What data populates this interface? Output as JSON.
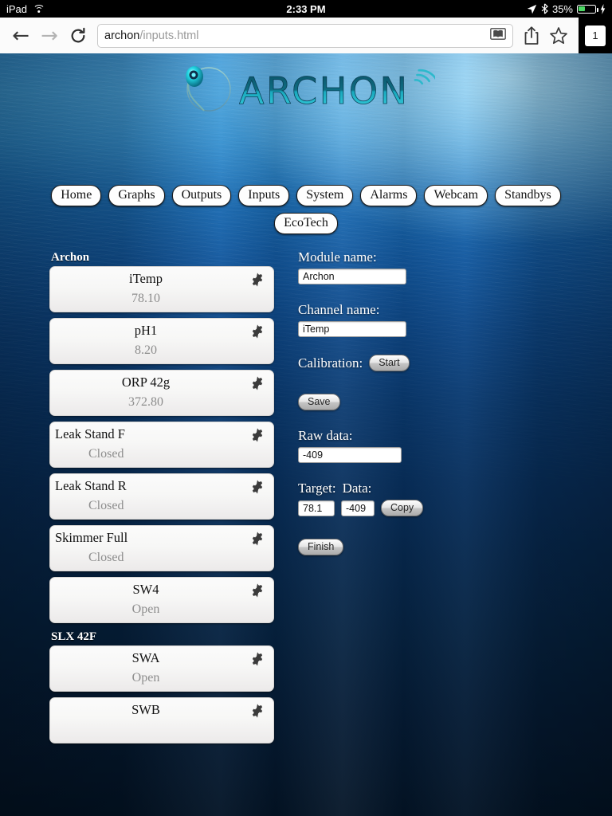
{
  "status_bar": {
    "device": "iPad",
    "wifi_icon": "wifi-icon",
    "time": "2:33 PM",
    "location_icon": "location-arrow-icon",
    "bluetooth_icon": "bluetooth-icon",
    "battery_percent": "35%",
    "battery_icon": "battery-icon",
    "charging_icon": "lightning-bolt-icon"
  },
  "browser": {
    "back_icon": "back-arrow-icon",
    "forward_icon": "forward-arrow-icon",
    "reload_icon": "reload-icon",
    "url_host": "archon",
    "url_path": "/inputs.html",
    "reader_icon": "reader-view-icon",
    "share_icon": "share-icon",
    "bookmark_icon": "star-icon",
    "tab_count": "1"
  },
  "site": {
    "logo_text": "ARCHON",
    "logo_mark_icon": "archon-circle-icon",
    "logo_wifi_icon": "signal-waves-icon"
  },
  "nav": {
    "row1": [
      {
        "label": "Home"
      },
      {
        "label": "Graphs"
      },
      {
        "label": "Outputs"
      },
      {
        "label": "Inputs"
      },
      {
        "label": "System"
      },
      {
        "label": "Alarms"
      },
      {
        "label": "Webcam"
      },
      {
        "label": "Standbys"
      }
    ],
    "row2": [
      {
        "label": "EcoTech"
      }
    ]
  },
  "groups": [
    {
      "title": "Archon",
      "items": [
        {
          "name": "iTemp",
          "value": "78.10",
          "wide": false,
          "gear_icon": "gear-icon"
        },
        {
          "name": "pH1",
          "value": "8.20",
          "wide": false,
          "gear_icon": "gear-icon"
        },
        {
          "name": "ORP 42g",
          "value": "372.80",
          "wide": false,
          "gear_icon": "gear-icon"
        },
        {
          "name": "Leak Stand F",
          "value": "Closed",
          "wide": true,
          "gear_icon": "gear-icon"
        },
        {
          "name": "Leak Stand R",
          "value": "Closed",
          "wide": true,
          "gear_icon": "gear-icon"
        },
        {
          "name": "Skimmer Full",
          "value": "Closed",
          "wide": true,
          "gear_icon": "gear-icon"
        },
        {
          "name": "SW4",
          "value": "Open",
          "wide": false,
          "gear_icon": "gear-icon"
        }
      ]
    },
    {
      "title": "SLX 42F",
      "items": [
        {
          "name": "SWA",
          "value": "Open",
          "wide": false,
          "gear_icon": "gear-icon"
        },
        {
          "name": "SWB",
          "value": "",
          "wide": false,
          "gear_icon": "gear-icon"
        }
      ]
    }
  ],
  "form": {
    "module_name_label": "Module name:",
    "module_name_value": "Archon",
    "channel_name_label": "Channel name:",
    "channel_name_value": "iTemp",
    "calibration_label": "Calibration:",
    "start_button": "Start",
    "save_button": "Save",
    "raw_data_label": "Raw data:",
    "raw_data_value": "-409",
    "target_label": "Target:",
    "data_label": "Data:",
    "target_value": "78.1",
    "data_value": "-409",
    "copy_button": "Copy",
    "finish_button": "Finish"
  },
  "colors": {
    "accent_blue": "#1f7ec4",
    "deep_blue": "#031426",
    "battery_green": "#4cd964",
    "logo_teal": "#1fd9e0"
  }
}
